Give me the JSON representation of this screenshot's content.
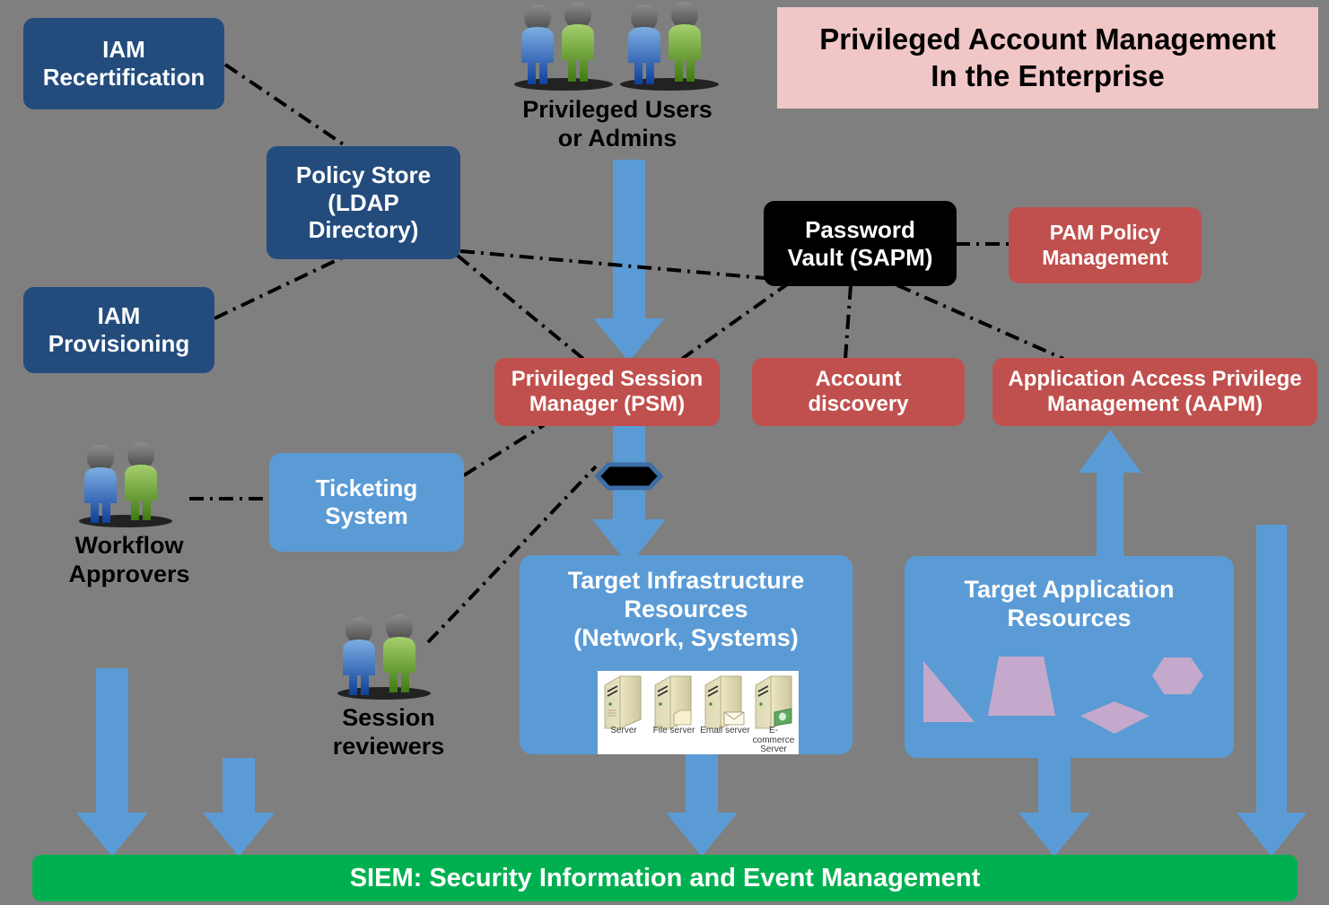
{
  "title_banner": {
    "line1": "Privileged Account Management",
    "line2": "In the Enterprise",
    "bg": "#f1c6c6",
    "text_color": "#000000"
  },
  "nodes": {
    "iam_recertification": "IAM\nRecertification",
    "policy_store": "Policy Store\n(LDAP\nDirectory)",
    "iam_provisioning": "IAM\nProvisioning",
    "ticketing_system": "Ticketing\nSystem",
    "password_vault": "Password\nVault (SAPM)",
    "pam_policy_management": "PAM Policy\nManagement",
    "privileged_session_manager": "Privileged Session\nManager (PSM)",
    "account_discovery": "Account\ndiscovery",
    "aapm": "Application Access Privilege\nManagement (AAPM)",
    "target_infrastructure": "Target Infrastructure\nResources\n(Network, Systems)",
    "target_application": "Target Application\nResources",
    "siem": "SIEM: Security Information and Event Management"
  },
  "actor_labels": {
    "privileged_users": "Privileged Users\nor Admins",
    "workflow_approvers": "Workflow\nApprovers",
    "session_reviewers": "Session\nreviewers"
  },
  "server_graphic": {
    "captions": [
      "Server",
      "File server",
      "Email server",
      "E-commerce\nServer"
    ]
  },
  "colors": {
    "background": "#7f7f7f",
    "navy": "#234c7d",
    "red": "#c0504d",
    "light_blue": "#5b9bd5",
    "black": "#000000",
    "pink": "#f1c6c6",
    "green": "#00b050",
    "arrow": "#5b9bd5",
    "shape_fill": "#c4a9cc",
    "connector_line": "#000000"
  },
  "chart_data": {
    "type": "diagram",
    "title": "Privileged Account Management In the Enterprise",
    "nodes": [
      {
        "id": "iam_recertification",
        "label": "IAM Recertification",
        "style": "navy"
      },
      {
        "id": "policy_store",
        "label": "Policy Store (LDAP Directory)",
        "style": "navy"
      },
      {
        "id": "iam_provisioning",
        "label": "IAM Provisioning",
        "style": "navy"
      },
      {
        "id": "ticketing_system",
        "label": "Ticketing System",
        "style": "light-blue"
      },
      {
        "id": "password_vault",
        "label": "Password Vault (SAPM)",
        "style": "black"
      },
      {
        "id": "pam_policy_management",
        "label": "PAM Policy Management",
        "style": "red"
      },
      {
        "id": "privileged_session_manager",
        "label": "Privileged Session Manager (PSM)",
        "style": "red"
      },
      {
        "id": "account_discovery",
        "label": "Account discovery",
        "style": "red"
      },
      {
        "id": "aapm",
        "label": "Application Access Privilege Management (AAPM)",
        "style": "red"
      },
      {
        "id": "target_infrastructure",
        "label": "Target Infrastructure Resources (Network, Systems)",
        "style": "light-blue"
      },
      {
        "id": "target_application",
        "label": "Target Application Resources",
        "style": "light-blue"
      },
      {
        "id": "siem",
        "label": "SIEM: Security Information and Event Management",
        "style": "green"
      },
      {
        "id": "privileged_users",
        "label": "Privileged Users or Admins",
        "style": "actor"
      },
      {
        "id": "workflow_approvers",
        "label": "Workflow Approvers",
        "style": "actor"
      },
      {
        "id": "session_reviewers",
        "label": "Session reviewers",
        "style": "actor"
      }
    ],
    "edges": [
      {
        "from": "iam_recertification",
        "to": "policy_store",
        "style": "dash-dot"
      },
      {
        "from": "iam_provisioning",
        "to": "policy_store",
        "style": "dash-dot"
      },
      {
        "from": "policy_store",
        "to": "privileged_session_manager",
        "style": "dash-dot"
      },
      {
        "from": "policy_store",
        "to": "password_vault",
        "style": "dash-dot"
      },
      {
        "from": "password_vault",
        "to": "pam_policy_management",
        "style": "dash-dot"
      },
      {
        "from": "password_vault",
        "to": "privileged_session_manager",
        "style": "dash-dot"
      },
      {
        "from": "password_vault",
        "to": "account_discovery",
        "style": "dash-dot"
      },
      {
        "from": "password_vault",
        "to": "aapm",
        "style": "dash-dot"
      },
      {
        "from": "workflow_approvers",
        "to": "ticketing_system",
        "style": "dash-dot"
      },
      {
        "from": "ticketing_system",
        "to": "privileged_session_manager",
        "style": "dash-dot"
      },
      {
        "from": "session_reviewers",
        "to": "privileged_session_manager",
        "style": "dash-dot"
      },
      {
        "from": "privileged_users",
        "to": "privileged_session_manager",
        "style": "blue-arrow"
      },
      {
        "from": "privileged_session_manager",
        "to": "target_infrastructure",
        "style": "blue-arrow"
      },
      {
        "from": "target_application",
        "to": "aapm",
        "style": "blue-arrow"
      },
      {
        "from": "target_infrastructure",
        "to": "siem",
        "style": "blue-arrow"
      },
      {
        "from": "target_application",
        "to": "siem",
        "style": "blue-arrow"
      },
      {
        "from": "workflow_approvers",
        "to": "siem",
        "style": "blue-arrow"
      },
      {
        "from": "ticketing_system",
        "to": "siem",
        "style": "blue-arrow"
      },
      {
        "from": "aapm",
        "to": "siem",
        "style": "blue-arrow"
      }
    ]
  }
}
